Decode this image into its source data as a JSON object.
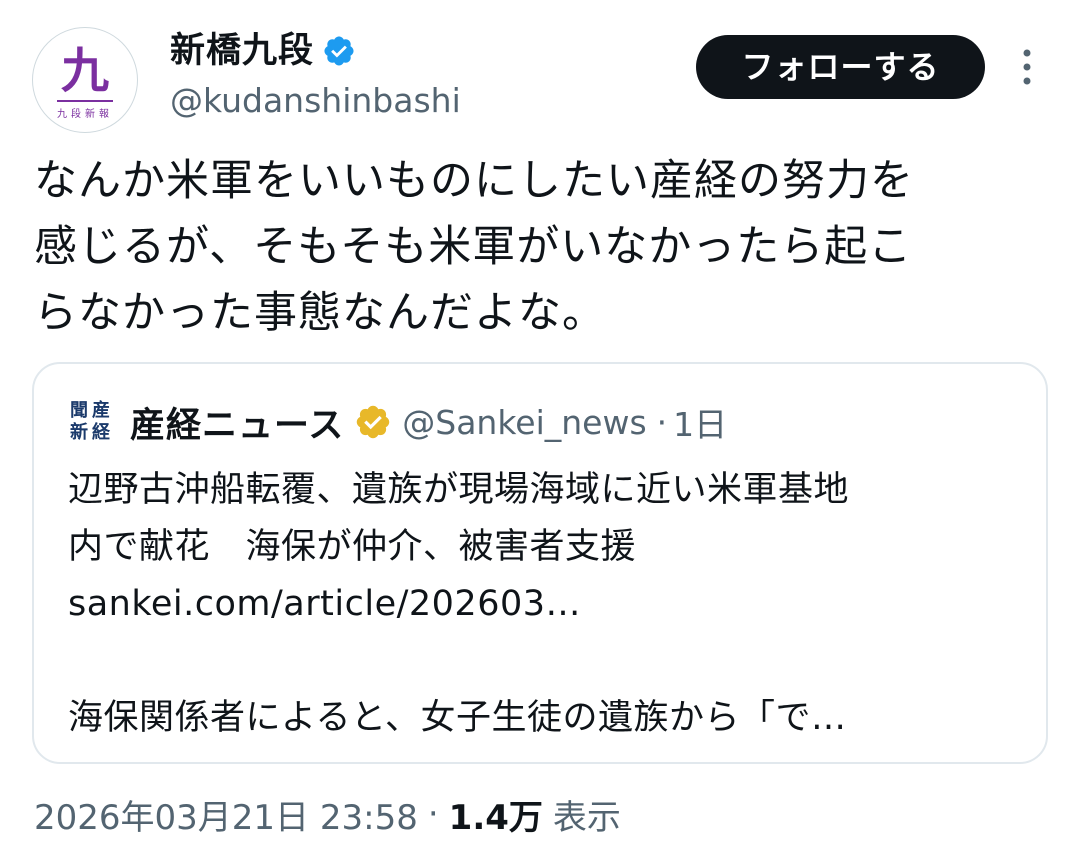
{
  "author": {
    "display_name": "新橋九段",
    "handle": "@kudanshinbashi",
    "avatar_kanji": "九",
    "avatar_subtext": "九段新報",
    "verified_badge_color": "#1d9bf0"
  },
  "actions": {
    "follow_label": "フォローする"
  },
  "tweet": {
    "lines": [
      "なんか米軍をいいものにしたい産経の努力を",
      "感じるが、そもそも米軍がいなかったら起こ",
      "らなかった事態なんだよな。"
    ]
  },
  "quote": {
    "avatar_chars": [
      "産",
      "経",
      "新",
      "聞"
    ],
    "name": "産経ニュース",
    "verified_badge_color": "#e8b829",
    "handle": "@Sankei_news",
    "separator": "·",
    "time": "1日",
    "body_lines": [
      "辺野古沖船転覆、遺族が現場海域に近い米軍基地",
      "内で献花　海保が仲介、被害者支援",
      "sankei.com/article/202603…",
      "",
      "海保関係者によると、女子生徒の遺族から「で…"
    ]
  },
  "meta": {
    "timestamp": "2026年03月21日 23:58",
    "separator": "·",
    "views": "1.4万",
    "views_label": "表示"
  },
  "colors": {
    "text_primary": "#0f1419",
    "text_secondary": "#536471",
    "border": "#e1e8ed",
    "accent_avatar": "#7b2fa0"
  }
}
